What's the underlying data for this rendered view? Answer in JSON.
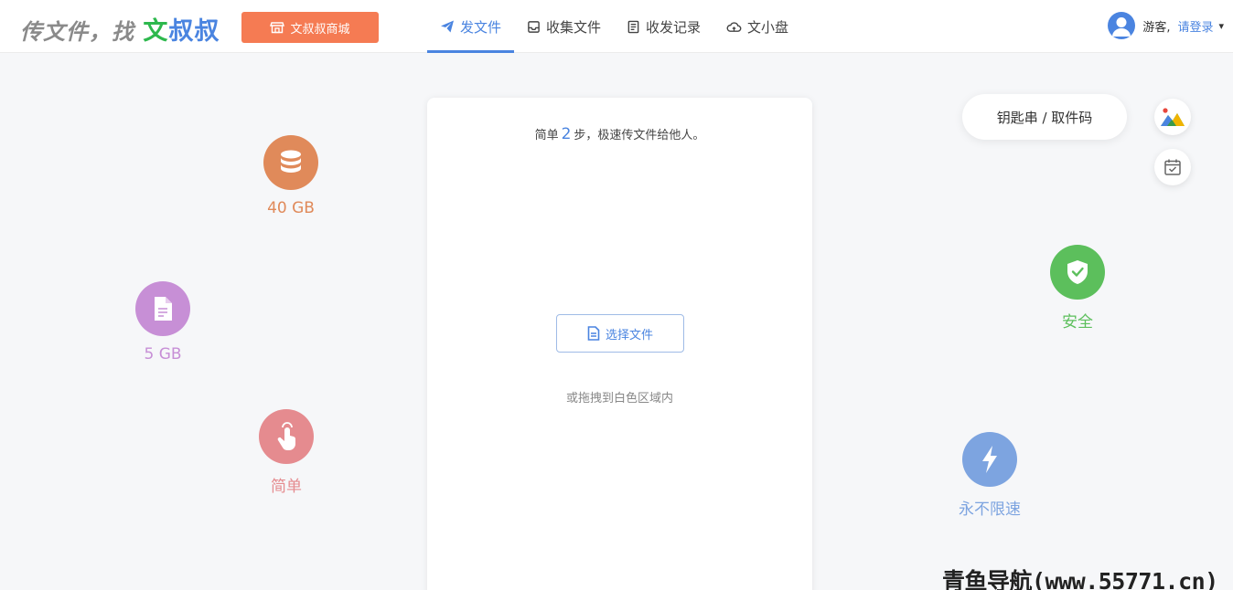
{
  "header": {
    "logo": {
      "part1": "传文件，找 ",
      "part2": "文",
      "part3": "叔叔"
    },
    "shop_button": {
      "label": "文叔叔商城",
      "icon": "shop-icon"
    },
    "nav": [
      {
        "label": "发文件",
        "icon": "paper-plane-icon",
        "active": true
      },
      {
        "label": "收集文件",
        "icon": "inbox-icon",
        "active": false
      },
      {
        "label": "收发记录",
        "icon": "record-icon",
        "active": false
      },
      {
        "label": "文小盘",
        "icon": "cloud-icon",
        "active": false
      }
    ],
    "user": {
      "guest_label": "游客,",
      "login_label": "请登录",
      "caret": "▾"
    }
  },
  "card": {
    "hint_prefix": "简单",
    "hint_number": "2",
    "hint_suffix": "步，极速传文件给他人。",
    "choose_button": "选择文件",
    "drag_hint": "或拖拽到白色区域内"
  },
  "features": {
    "storage": {
      "label": "40 GB",
      "color": "#e08a5a",
      "icon": "database-icon"
    },
    "filesize": {
      "label": "5 GB",
      "color": "#c78fd6",
      "icon": "file-icon"
    },
    "simple": {
      "label": "简单",
      "color": "#e58b8f",
      "icon": "tap-icon"
    },
    "secure": {
      "label": "安全",
      "color": "#5cbf5c",
      "icon": "shield-check-icon"
    },
    "speed": {
      "label": "永不限速",
      "color": "#7da4e0",
      "icon": "bolt-icon"
    }
  },
  "code_pill": {
    "label": "钥匙串 / 取件码"
  },
  "side_buttons": {
    "top_icon": "image-icon",
    "bottom_icon": "calendar-check-icon"
  },
  "colors": {
    "accent": "#4a84e0",
    "shop": "#f57b53",
    "logo_green": "#2db84d"
  },
  "watermark": "青鱼导航(www.55771.cn)"
}
